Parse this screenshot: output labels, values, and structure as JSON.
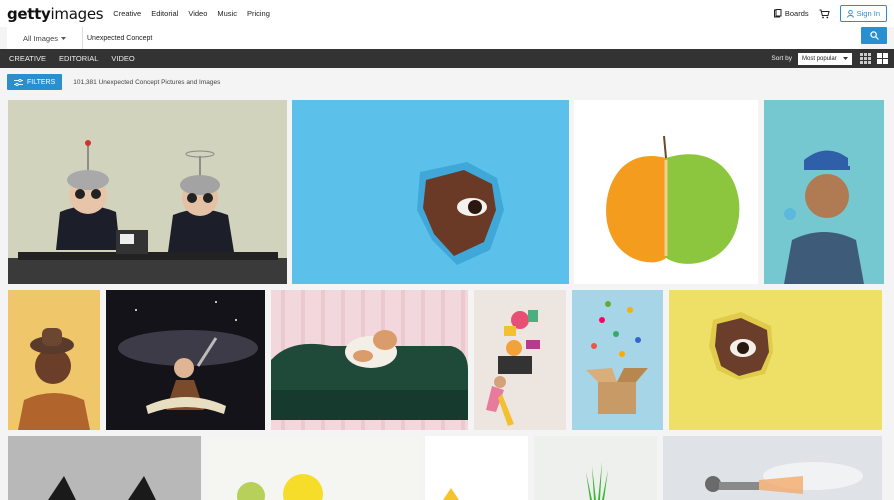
{
  "brand": {
    "strong": "getty",
    "light": "images"
  },
  "nav": [
    "Creative",
    "Editorial",
    "Video",
    "Music",
    "Pricing"
  ],
  "top_right": {
    "boards": "Boards",
    "signin": "Sign In"
  },
  "search": {
    "category": "All Images",
    "query": "Unexpected Concept"
  },
  "tabs": [
    "CREATIVE",
    "EDITORIAL",
    "VIDEO"
  ],
  "sort": {
    "label": "Sort by",
    "value": "Most popular"
  },
  "filters": {
    "label": "FILTERS"
  },
  "results": {
    "count_text": "101,381 Unexpected Concept Pictures and Images"
  },
  "colors": {
    "accent": "#2a8fce",
    "tabbar": "#333333"
  },
  "icons": {
    "boards": "boards-icon",
    "cart": "cart-icon",
    "user": "user-icon",
    "search": "search-icon",
    "filter": "filter-icon",
    "grid-small": "grid-small-icon",
    "grid-large": "grid-large-icon"
  }
}
